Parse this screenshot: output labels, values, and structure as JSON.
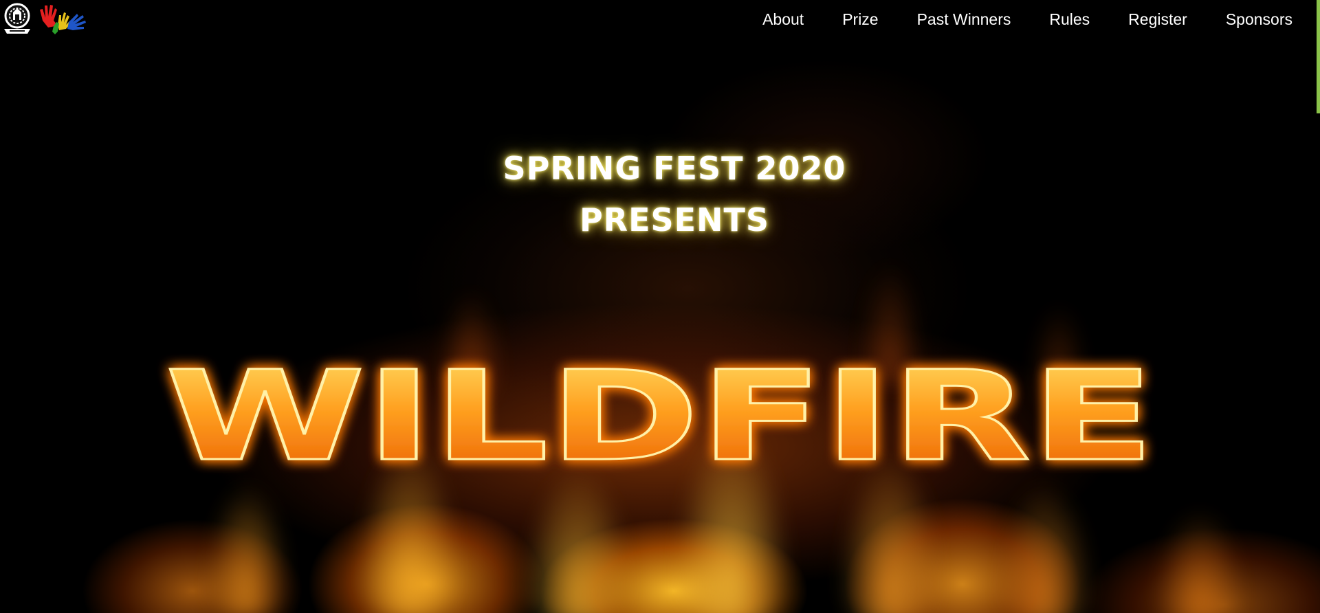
{
  "header": {
    "nav": [
      {
        "label": "About"
      },
      {
        "label": "Prize"
      },
      {
        "label": "Past Winners"
      },
      {
        "label": "Rules"
      },
      {
        "label": "Register"
      },
      {
        "label": "Sponsors"
      }
    ],
    "logos": [
      "iit-emblem-logo",
      "spring-fest-hands-logo"
    ]
  },
  "hero": {
    "line1": "SPRING FEST 2020",
    "line2": "PRESENTS",
    "title": "WILDFIRE"
  },
  "colors": {
    "background": "#000000",
    "nav_text": "#ffffff",
    "glow": "#ffe45a",
    "fire_orange": "#ff8c00",
    "fire_yellow": "#ffd23c",
    "scroll_accent": "#8bc34a"
  }
}
